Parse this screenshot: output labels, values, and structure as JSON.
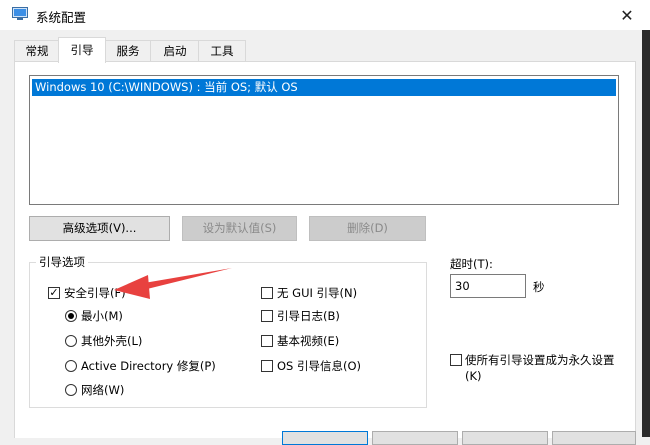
{
  "window": {
    "title": "系统配置",
    "close_glyph": "✕"
  },
  "tabs": [
    {
      "label": "常规",
      "active": false
    },
    {
      "label": "引导",
      "active": true
    },
    {
      "label": "服务",
      "active": false
    },
    {
      "label": "启动",
      "active": false
    },
    {
      "label": "工具",
      "active": false
    }
  ],
  "os_list": {
    "items": [
      "Windows 10 (C:\\WINDOWS) : 当前 OS; 默认 OS"
    ]
  },
  "buttons": {
    "advanced": "高级选项(V)...",
    "set_default": "设为默认值(S)",
    "delete": "删除(D)"
  },
  "boot_options": {
    "title": "引导选项",
    "safe_boot": {
      "label": "安全引导(F)",
      "checked": true
    },
    "radios": [
      {
        "label": "最小(M)",
        "selected": true
      },
      {
        "label": "其他外壳(L)",
        "selected": false
      },
      {
        "label": "Active Directory 修复(P)",
        "selected": false
      },
      {
        "label": "网络(W)",
        "selected": false
      }
    ],
    "right_checks": [
      {
        "label": "无 GUI 引导(N)",
        "checked": false
      },
      {
        "label": "引导日志(B)",
        "checked": false
      },
      {
        "label": "基本视频(E)",
        "checked": false
      },
      {
        "label": "OS 引导信息(O)",
        "checked": false
      }
    ]
  },
  "timeout": {
    "label": "超时(T):",
    "value": "30",
    "unit": "秒"
  },
  "permanent": {
    "label_line1": "使所有引导设置成为永久设置",
    "label_line2": "(K)",
    "checked": false
  },
  "colors": {
    "selection": "#0078d7",
    "annotation_arrow": "#e8413f"
  },
  "icons": {
    "app": "system-config-icon",
    "close": "close-icon",
    "check": "checkmark-icon"
  }
}
